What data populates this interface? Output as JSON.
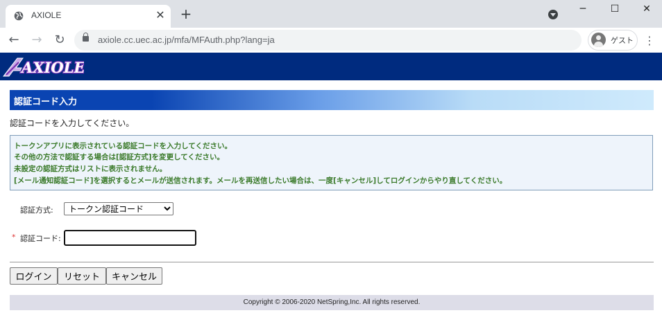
{
  "browser": {
    "tab_title": "AXIOLE",
    "tab_close": "✕",
    "new_tab": "+",
    "window_controls": {
      "minimize": "─",
      "maximize": "☐",
      "close": "✕"
    },
    "nav": {
      "back": "←",
      "forward": "→",
      "reload": "↻"
    },
    "url": "axiole.cc.uec.ac.jp/mfa/MFAuth.php?lang=ja",
    "profile_label": "ゲスト",
    "menu": "⋮"
  },
  "header": {
    "logo_text": "AXIOLE"
  },
  "page": {
    "section_title": "認証コード入力",
    "intro": "認証コードを入力してください。",
    "notice_lines": [
      "トークンアプリに表示されている認証コードを入力してください。",
      "その他の方法で認証する場合は[認証方式]を変更してください。",
      "未設定の認証方式はリストに表示されません。",
      "[メール通知認証コード]を選択するとメールが送信されます。メールを再送信したい場合は、一度[キャンセル]してログインからやり直してください。"
    ],
    "method_label": "認証方式:",
    "method_selected": "トークン認証コード",
    "required_mark": "*",
    "code_label": "認証コード:",
    "code_value": ""
  },
  "buttons": {
    "login": "ログイン",
    "reset": "リセット",
    "cancel": "キャンセル"
  },
  "footer": {
    "copyright": "Copyright © 2006-2020 NetSpring,Inc. All rights reserved."
  },
  "colors": {
    "banner": "#002b7f",
    "notice_text": "#3a7a2a",
    "required": "#dd3333"
  }
}
